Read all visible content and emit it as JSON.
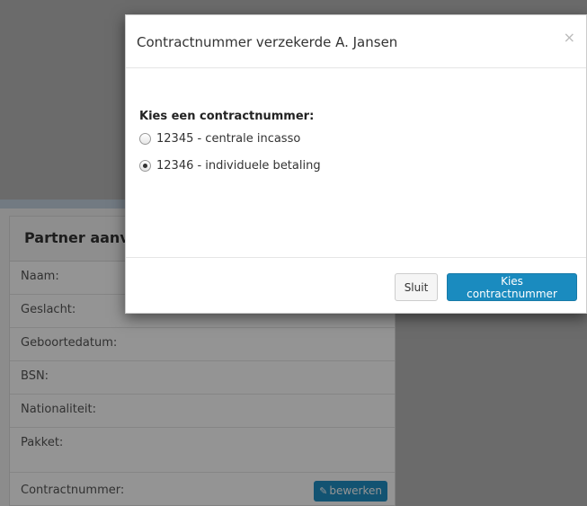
{
  "background": {
    "partner_heading": "Partner aanvr",
    "rows": [
      {
        "label": "Naam:"
      },
      {
        "label": "Geslacht:"
      },
      {
        "label": "Geboortedatum:"
      },
      {
        "label": "BSN:"
      },
      {
        "label": "Nationaliteit:"
      },
      {
        "label": "Pakket:"
      }
    ],
    "contract_row_label": "Contractnummer:",
    "edit_button_label": "bewerken",
    "edit_icon": "pencil-icon"
  },
  "modal": {
    "title": "Contractnummer verzekerde A. Jansen",
    "close_symbol": "×",
    "choose_label": "Kies een contractnummer:",
    "options": [
      {
        "label": "12345 - centrale incasso",
        "checked": false
      },
      {
        "label": "12346 - individuele betaling",
        "checked": true
      }
    ],
    "buttons": {
      "close_label": "Sluit",
      "primary_label": "Kies contractnummer"
    }
  },
  "colors": {
    "primary": "#1a8bbf",
    "backdrop": "#000000"
  }
}
